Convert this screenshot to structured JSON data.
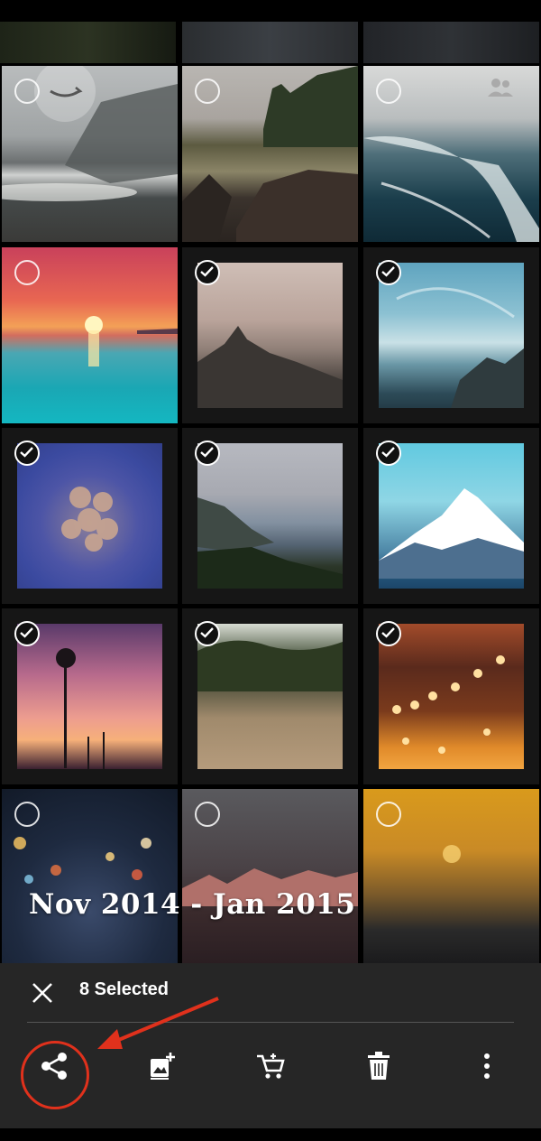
{
  "date_range": "Nov 2014 - Jan 2015",
  "selection": {
    "count_label": "8 Selected"
  },
  "toolbar": {
    "actions": [
      "share-icon",
      "add-to-album-icon",
      "order-prints-icon",
      "delete-icon",
      "more-options-icon"
    ]
  },
  "grid": {
    "rows": [
      [
        {
          "selected": false,
          "badge": "amazon-icon"
        },
        {
          "selected": false
        },
        {
          "selected": false,
          "badge": "family-icon"
        }
      ],
      [
        {
          "selected": false
        },
        {
          "selected": true
        },
        {
          "selected": true
        }
      ],
      [
        {
          "selected": true
        },
        {
          "selected": true
        },
        {
          "selected": true
        }
      ],
      [
        {
          "selected": true
        },
        {
          "selected": true
        },
        {
          "selected": true
        }
      ],
      [
        {
          "selected": false
        },
        {
          "selected": false
        },
        {
          "selected": false
        }
      ]
    ]
  },
  "colors": {
    "panel": "#262626",
    "annotation": "#e0311c",
    "background": "#000000"
  }
}
